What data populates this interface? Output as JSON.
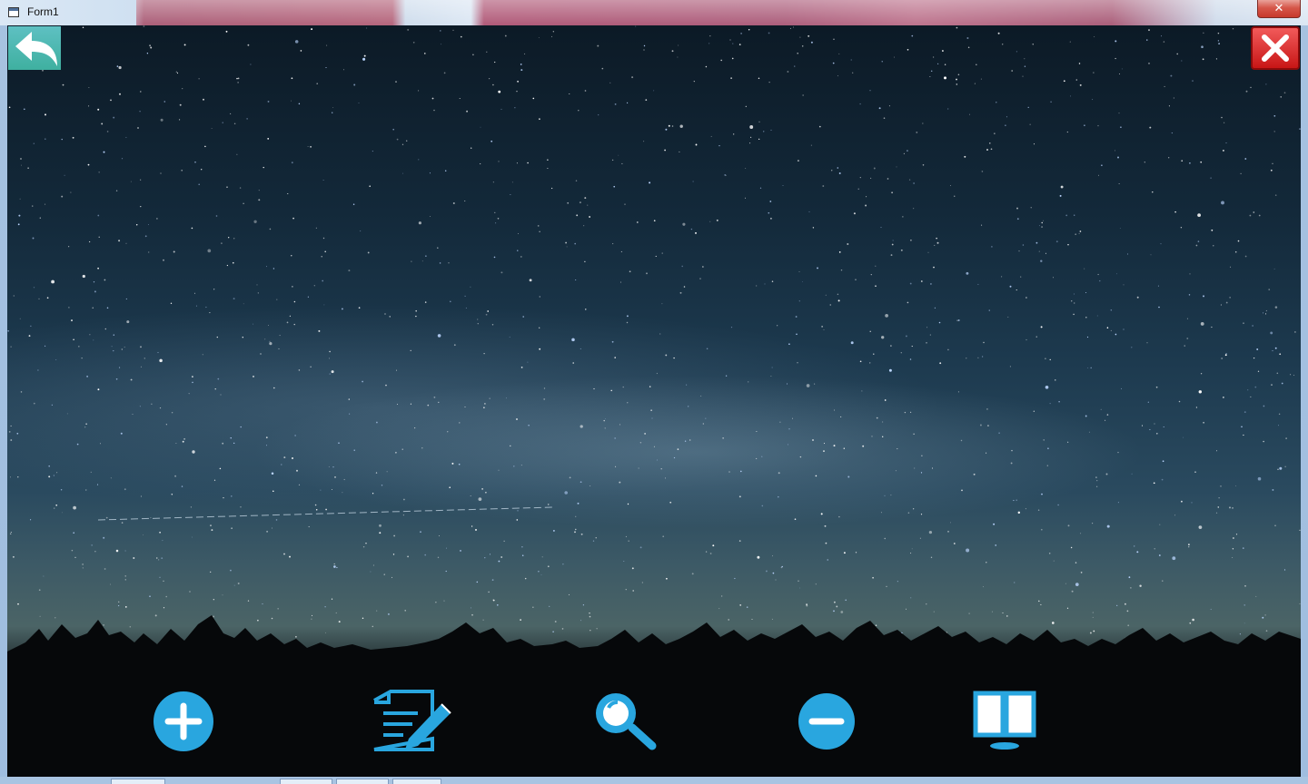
{
  "window": {
    "title": "Form1",
    "close_glyph": "✕"
  },
  "toolbar": {
    "back_icon": "back-arrow-icon",
    "close_icon": "close-x-icon"
  },
  "actions": [
    {
      "name": "add",
      "icon": "plus-circle-icon"
    },
    {
      "name": "edit",
      "icon": "edit-document-icon"
    },
    {
      "name": "search",
      "icon": "magnifier-icon"
    },
    {
      "name": "remove",
      "icon": "minus-circle-icon"
    },
    {
      "name": "book",
      "icon": "open-book-icon"
    }
  ],
  "colors": {
    "accent": "#29a6df",
    "back_button": "#4cb6ad",
    "close_button": "#e02a2a"
  }
}
